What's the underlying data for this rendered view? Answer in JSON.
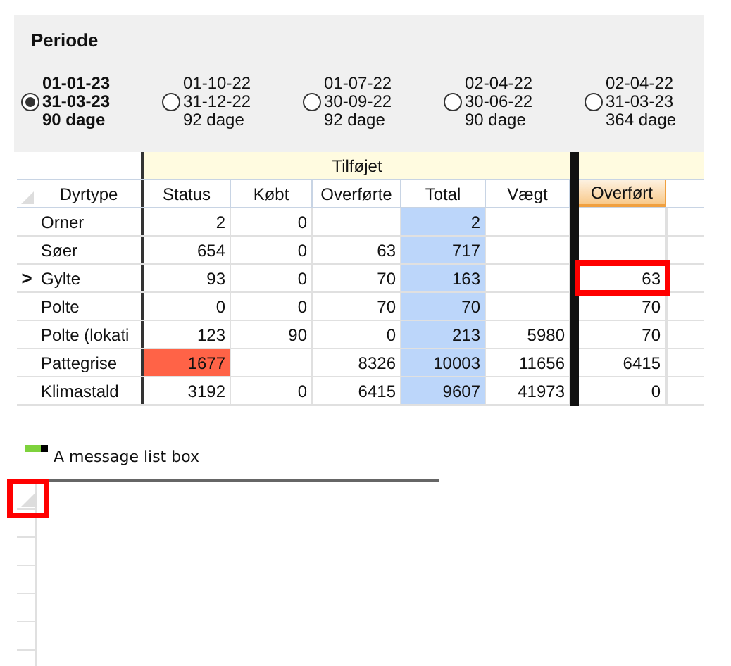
{
  "period": {
    "title": "Periode",
    "options": [
      {
        "from": "01-01-23",
        "to": "31-03-23",
        "days": "90 dage",
        "selected": true
      },
      {
        "from": "01-10-22",
        "to": "31-12-22",
        "days": "92 dage",
        "selected": false
      },
      {
        "from": "01-07-22",
        "to": "30-09-22",
        "days": "92 dage",
        "selected": false
      },
      {
        "from": "02-04-22",
        "to": "30-06-22",
        "days": "90 dage",
        "selected": false
      },
      {
        "from": "02-04-22",
        "to": "31-03-23",
        "days": "364 dage",
        "selected": false
      }
    ]
  },
  "grid": {
    "group_header": "Tilføjet",
    "current_marker": ">",
    "columns": [
      "Dyrtype",
      "Status",
      "Købt",
      "Overførte",
      "Total",
      "Vægt",
      "Overført"
    ],
    "rows": [
      {
        "cells": [
          "Orner",
          "2",
          "0",
          "",
          "2",
          "",
          ""
        ],
        "current": false,
        "status_alert": false,
        "highlighted": false
      },
      {
        "cells": [
          "Søer",
          "654",
          "0",
          "63",
          "717",
          "",
          ""
        ],
        "current": false,
        "status_alert": false,
        "highlighted": false
      },
      {
        "cells": [
          "Gylte",
          "93",
          "0",
          "70",
          "163",
          "",
          "63"
        ],
        "current": true,
        "status_alert": false,
        "highlighted": true
      },
      {
        "cells": [
          "Polte",
          "0",
          "0",
          "70",
          "70",
          "",
          "70"
        ],
        "current": false,
        "status_alert": false,
        "highlighted": false
      },
      {
        "cells": [
          "Polte (lokati",
          "123",
          "90",
          "0",
          "213",
          "5980",
          "70"
        ],
        "current": false,
        "status_alert": false,
        "highlighted": false
      },
      {
        "cells": [
          "Pattegrise",
          "1677",
          "",
          "8326",
          "10003",
          "11656",
          "6415"
        ],
        "current": false,
        "status_alert": true,
        "highlighted": false
      },
      {
        "cells": [
          "Klimastald",
          "3192",
          "0",
          "6415",
          "9607",
          "41973",
          "0"
        ],
        "current": false,
        "status_alert": false,
        "highlighted": false
      }
    ]
  },
  "messages": {
    "title": "A message list box",
    "corner_highlighted": true
  }
}
